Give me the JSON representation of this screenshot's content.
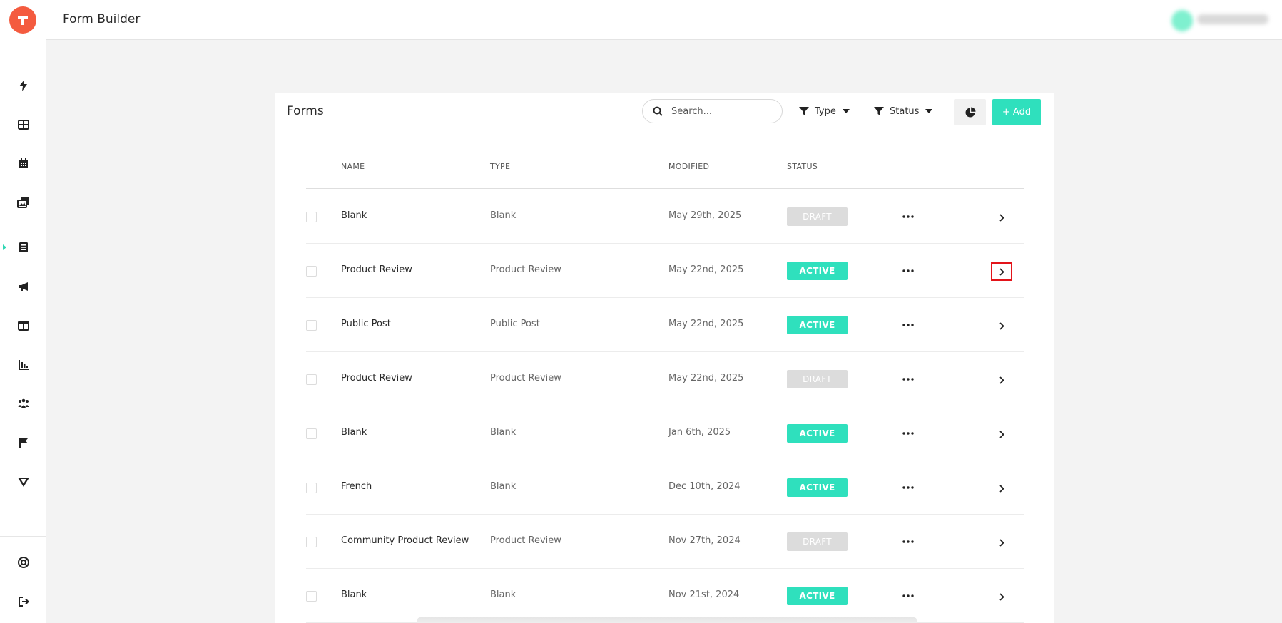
{
  "header": {
    "title": "Form Builder"
  },
  "sidebar": {
    "items": [
      {
        "icon": "lightning-icon"
      },
      {
        "icon": "grid-icon"
      },
      {
        "icon": "calendar-icon"
      },
      {
        "icon": "images-icon"
      },
      {
        "icon": "list-icon",
        "active": true
      },
      {
        "icon": "megaphone-icon"
      },
      {
        "icon": "layout-icon"
      },
      {
        "icon": "bar-chart-icon"
      },
      {
        "icon": "users-icon"
      },
      {
        "icon": "flag-icon"
      },
      {
        "icon": "v-logo-icon"
      }
    ],
    "bottom_items": [
      {
        "icon": "help-lifebuoy-icon"
      },
      {
        "icon": "logout-icon"
      }
    ]
  },
  "toolbar": {
    "title": "Forms",
    "search_placeholder": "Search...",
    "type_filter_label": "Type",
    "status_filter_label": "Status",
    "add_label": "+ Add"
  },
  "table": {
    "headers": {
      "name": "NAME",
      "type": "TYPE",
      "modified": "MODIFIED",
      "status": "STATUS"
    },
    "rows": [
      {
        "name": "Blank",
        "type": "Blank",
        "modified": "May 29th, 2025",
        "status": "DRAFT"
      },
      {
        "name": "Product Review",
        "type": "Product Review",
        "modified": "May 22nd, 2025",
        "status": "ACTIVE"
      },
      {
        "name": "Public Post",
        "type": "Public Post",
        "modified": "May 22nd, 2025",
        "status": "ACTIVE"
      },
      {
        "name": "Product Review",
        "type": "Product Review",
        "modified": "May 22nd, 2025",
        "status": "DRAFT"
      },
      {
        "name": "Blank",
        "type": "Blank",
        "modified": "Jan 6th, 2025",
        "status": "ACTIVE"
      },
      {
        "name": "French",
        "type": "Blank",
        "modified": "Dec 10th, 2024",
        "status": "ACTIVE"
      },
      {
        "name": "Community Product Review",
        "type": "Product Review",
        "modified": "Nov 27th, 2024",
        "status": "DRAFT"
      },
      {
        "name": "Blank",
        "type": "Blank",
        "modified": "Nov 21st, 2024",
        "status": "ACTIVE"
      }
    ]
  },
  "colors": {
    "accent": "#2fe0bd",
    "logo": "#f45b3f",
    "draft": "#dcdcdc",
    "highlight": "#e3141a"
  }
}
